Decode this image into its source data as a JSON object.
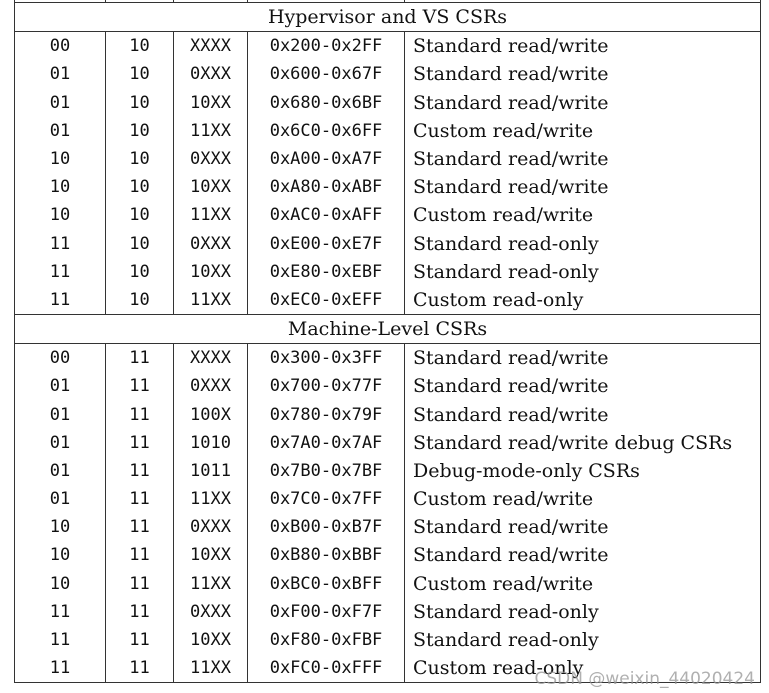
{
  "sections": [
    {
      "title": "Hypervisor and VS CSRs",
      "rows": [
        [
          "00",
          "10",
          "XXXX",
          "0x200-0x2FF",
          "Standard read/write"
        ],
        [
          "01",
          "10",
          "0XXX",
          "0x600-0x67F",
          "Standard read/write"
        ],
        [
          "01",
          "10",
          "10XX",
          "0x680-0x6BF",
          "Standard read/write"
        ],
        [
          "01",
          "10",
          "11XX",
          "0x6C0-0x6FF",
          "Custom read/write"
        ],
        [
          "10",
          "10",
          "0XXX",
          "0xA00-0xA7F",
          "Standard read/write"
        ],
        [
          "10",
          "10",
          "10XX",
          "0xA80-0xABF",
          "Standard read/write"
        ],
        [
          "10",
          "10",
          "11XX",
          "0xAC0-0xAFF",
          "Custom read/write"
        ],
        [
          "11",
          "10",
          "0XXX",
          "0xE00-0xE7F",
          "Standard read-only"
        ],
        [
          "11",
          "10",
          "10XX",
          "0xE80-0xEBF",
          "Standard read-only"
        ],
        [
          "11",
          "10",
          "11XX",
          "0xEC0-0xEFF",
          "Custom read-only"
        ]
      ]
    },
    {
      "title": "Machine-Level CSRs",
      "rows": [
        [
          "00",
          "11",
          "XXXX",
          "0x300-0x3FF",
          "Standard read/write"
        ],
        [
          "01",
          "11",
          "0XXX",
          "0x700-0x77F",
          "Standard read/write"
        ],
        [
          "01",
          "11",
          "100X",
          "0x780-0x79F",
          "Standard read/write"
        ],
        [
          "01",
          "11",
          "1010",
          "0x7A0-0x7AF",
          "Standard read/write debug CSRs"
        ],
        [
          "01",
          "11",
          "1011",
          "0x7B0-0x7BF",
          "Debug-mode-only CSRs"
        ],
        [
          "01",
          "11",
          "11XX",
          "0x7C0-0x7FF",
          "Custom read/write"
        ],
        [
          "10",
          "11",
          "0XXX",
          "0xB00-0xB7F",
          "Standard read/write"
        ],
        [
          "10",
          "11",
          "10XX",
          "0xB80-0xBBF",
          "Standard read/write"
        ],
        [
          "10",
          "11",
          "11XX",
          "0xBC0-0xBFF",
          "Custom read/write"
        ],
        [
          "11",
          "11",
          "0XXX",
          "0xF00-0xF7F",
          "Standard read-only"
        ],
        [
          "11",
          "11",
          "10XX",
          "0xF80-0xFBF",
          "Standard read-only"
        ],
        [
          "11",
          "11",
          "11XX",
          "0xFC0-0xFFF",
          "Custom read-only"
        ]
      ]
    }
  ],
  "watermark": "CSDN @weixin_44020424"
}
